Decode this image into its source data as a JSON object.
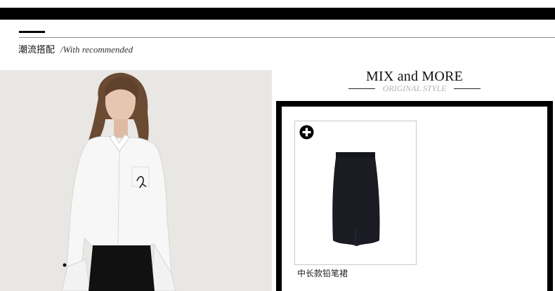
{
  "section": {
    "title_cn": "潮流搭配",
    "title_en": "/With recommended"
  },
  "mix": {
    "title": "MIX and MORE",
    "subtitle": "ORIGINAL STYLE"
  },
  "products": [
    {
      "name": "中长款铅笔裙",
      "icon": "plus-circle-icon"
    }
  ],
  "colors": {
    "bar": "#000000",
    "photo_background": "#e9e7e4",
    "subtitle": "#b3b3b3",
    "skirt": "#1b1b24"
  }
}
